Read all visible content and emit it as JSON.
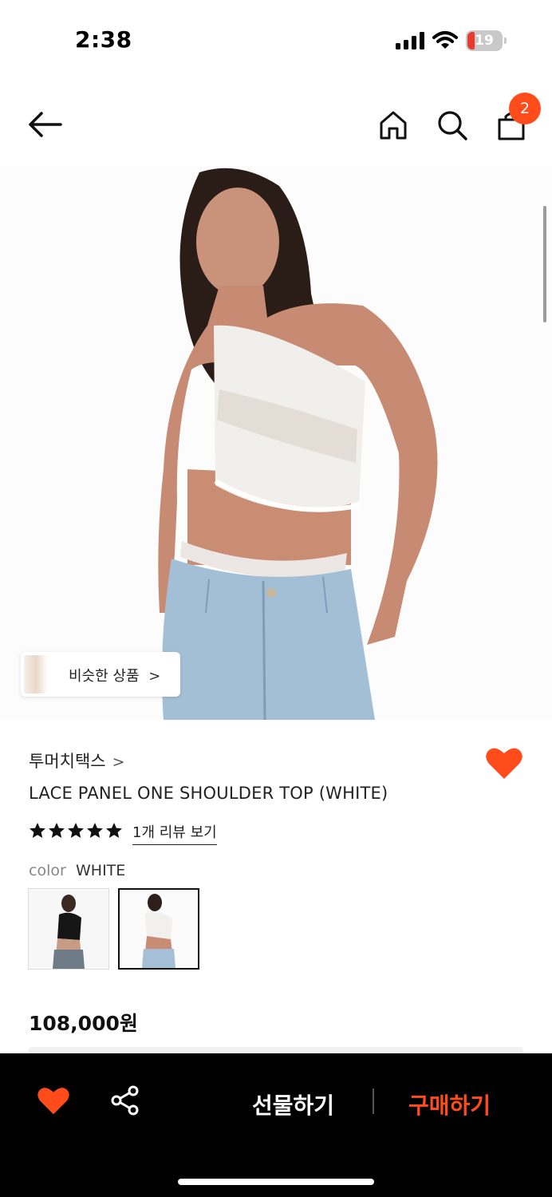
{
  "status_bar": {
    "time": "2:38",
    "battery_level": "19",
    "icons": [
      "signal-icon",
      "wifi-icon",
      "battery-icon"
    ]
  },
  "header": {
    "icons": [
      "back-arrow-icon",
      "home-icon",
      "search-icon",
      "shopping-bag-icon"
    ],
    "cart_count": "2"
  },
  "product": {
    "similar_products_label": "비슷한 상품",
    "similar_chevron": ">",
    "brand": "투머치택스",
    "brand_chevron": ">",
    "title": "LACE PANEL ONE SHOULDER TOP (WHITE)",
    "rating_stars": 5,
    "review_link": "1개 리뷰 보기",
    "color_label": "color",
    "color_value": "WHITE",
    "swatches": [
      {
        "name": "black",
        "selected": false
      },
      {
        "name": "white",
        "selected": true
      }
    ],
    "price": "108,000원"
  },
  "bottom_bar": {
    "gift_label": "선물하기",
    "buy_label": "구매하기"
  },
  "colors": {
    "accent": "#ff4c1a",
    "bar_background": "#000000",
    "text": "#222222"
  }
}
